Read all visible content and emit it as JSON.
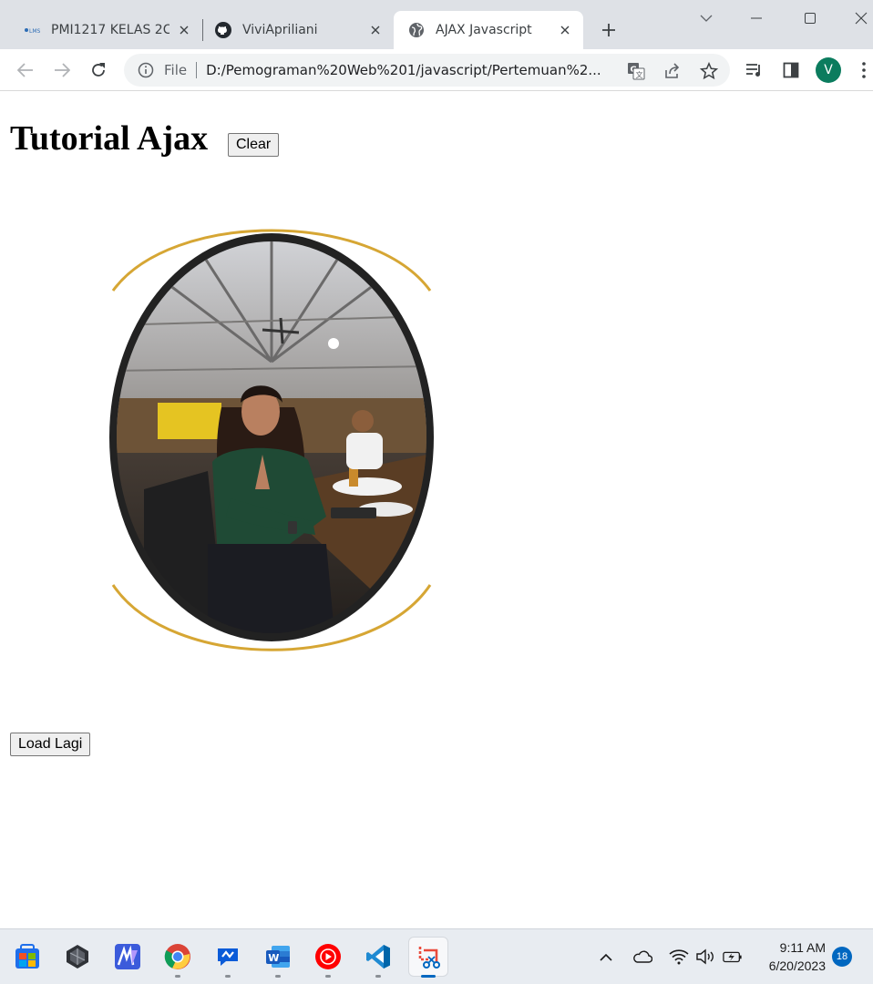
{
  "browser": {
    "tabs": [
      {
        "title": "PMI1217 KELAS 2C",
        "favicon": "lms-icon",
        "active": false
      },
      {
        "title": "ViviApriliani",
        "favicon": "github-icon",
        "active": false
      },
      {
        "title": "AJAX Javascript",
        "favicon": "globe-icon",
        "active": true
      }
    ],
    "address": {
      "scheme_label": "File",
      "url": "D:/Pemograman%20Web%201/javascript/Pertemuan%2..."
    },
    "profile_initial": "V"
  },
  "page": {
    "title": "Tutorial Ajax",
    "clear_button": "Clear",
    "load_button": "Load Lagi",
    "image": {
      "subject": "portrait-photo",
      "frame_colors": {
        "ring": "#2a2a2a",
        "arc": "#d6a634"
      }
    }
  },
  "taskbar": {
    "apps": [
      "start-icon",
      "unity-icon",
      "kinemaster-icon",
      "chrome-icon",
      "quickassist-icon",
      "word-icon",
      "youtube-music-icon",
      "vscode-icon",
      "snipping-tool-icon"
    ],
    "time": "9:11 AM",
    "date": "6/20/2023",
    "notification_count": "18"
  }
}
